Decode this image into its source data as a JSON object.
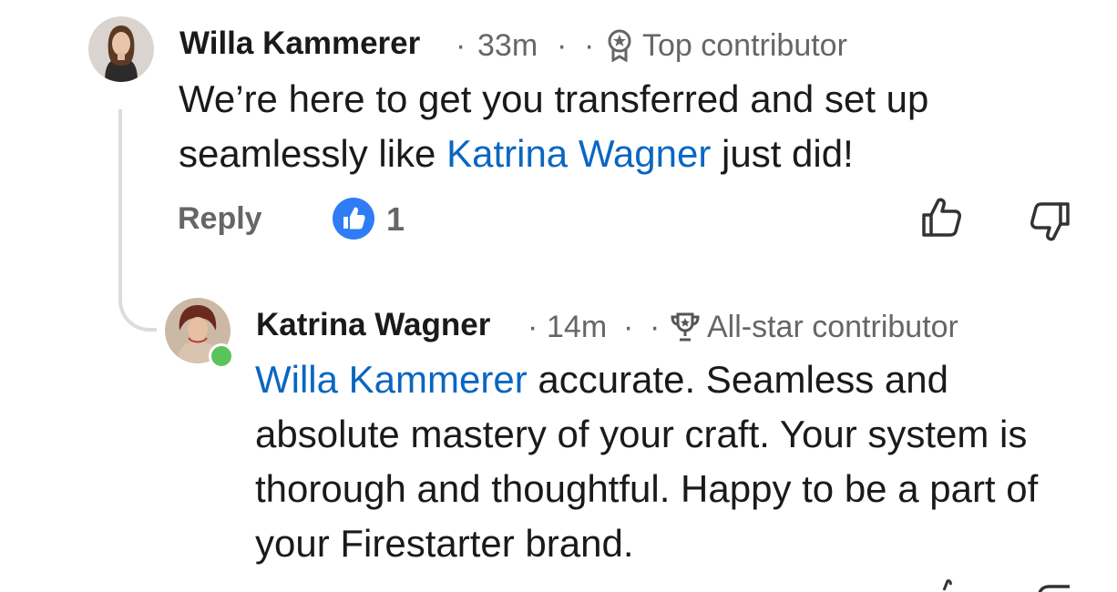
{
  "comments": [
    {
      "author": "Willa Kammerer",
      "time": "33m",
      "dot": "·",
      "badge": "Top contributor",
      "text_before": "We’re here to get you transferred and set up seamlessly like ",
      "mention": "Katrina Wagner",
      "text_after": " just did!",
      "reply_label": "Reply",
      "reaction_count": "1",
      "reaction_icon": "like-icon"
    },
    {
      "author": "Katrina Wagner",
      "time": "14m",
      "dot": "·",
      "badge": "All-star contributor",
      "online": true,
      "mention": "Willa Kammerer",
      "text_after": " accurate. Seamless and absolute mastery of your craft.  Your system is thorough and thoughtful.  Happy to be a part of your Firestarter brand."
    }
  ],
  "colors": {
    "mention": "#0a66c2",
    "like_badge": "#2f7cf6",
    "online": "#5ac35a",
    "meta": "#666666"
  }
}
